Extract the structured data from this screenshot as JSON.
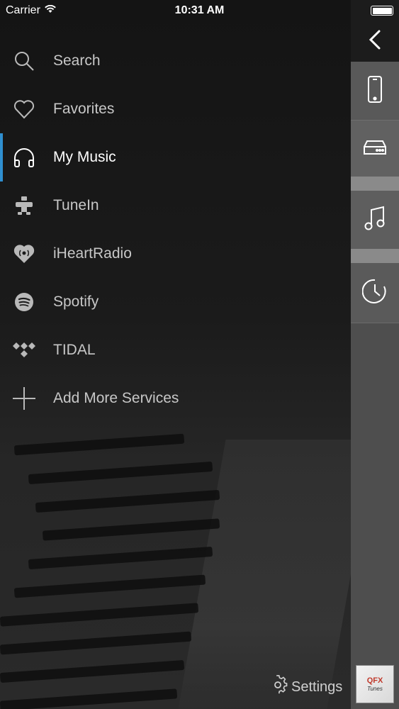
{
  "status_bar": {
    "carrier": "Carrier",
    "time": "10:31 AM"
  },
  "menu": {
    "items": [
      {
        "label": "Search",
        "icon": "search-icon"
      },
      {
        "label": "Favorites",
        "icon": "heart-icon"
      },
      {
        "label": "My Music",
        "icon": "headphones-icon",
        "selected": true
      },
      {
        "label": "TuneIn",
        "icon": "tunein-icon"
      },
      {
        "label": "iHeartRadio",
        "icon": "iheartradio-icon"
      },
      {
        "label": "Spotify",
        "icon": "spotify-icon"
      },
      {
        "label": "TIDAL",
        "icon": "tidal-icon"
      },
      {
        "label": "Add More Services",
        "icon": "plus-icon"
      }
    ]
  },
  "rail": {
    "items": [
      "back-icon",
      "phone-icon",
      "device-icon",
      "music-note-icon",
      "clock-icon"
    ]
  },
  "footer": {
    "settings_label": "Settings",
    "album_art_text": "QFX",
    "album_art_sub": "Tunes"
  },
  "colors": {
    "accent": "#2f8fd0",
    "background": "#1a1a1a",
    "rail": "#5a5a5a"
  }
}
